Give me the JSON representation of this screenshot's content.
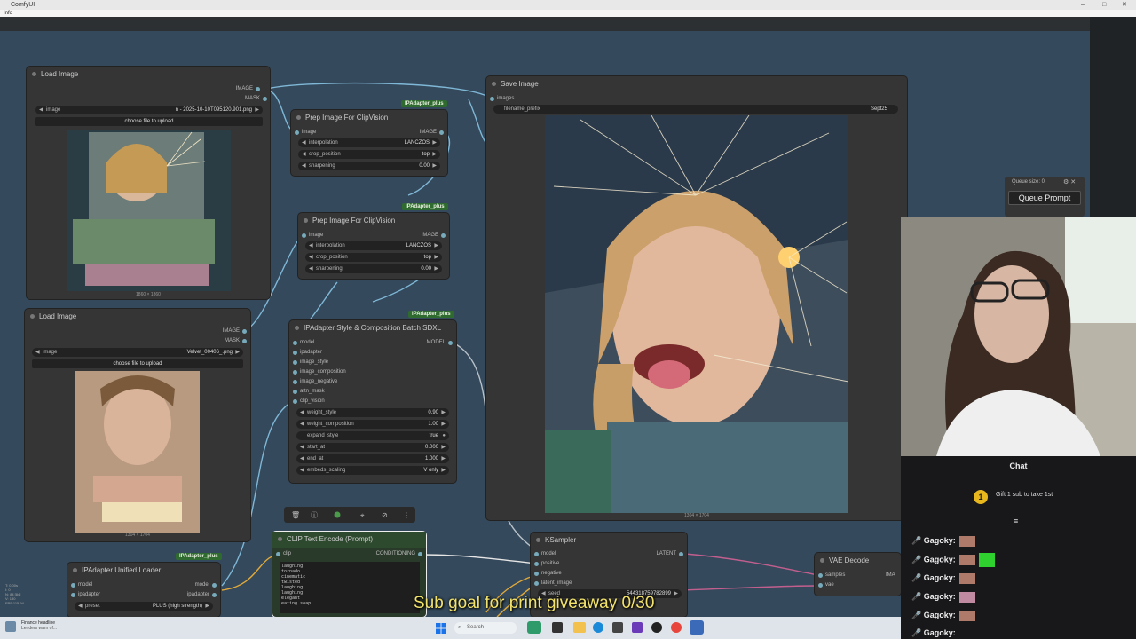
{
  "window": {
    "title": "ComfyUI",
    "menu": "Info"
  },
  "colors": {
    "canvas": "#34495b",
    "node": "#353535",
    "wire_pink": "#c35f8f",
    "wire_blue": "#7fb7d6",
    "wire_yellow": "#e0a93a",
    "badge": "#2f6b2f",
    "subgoal": "#f3e36b"
  },
  "nodes": {
    "load_image_1": {
      "title": "Load Image",
      "outputs": [
        "IMAGE",
        "MASK"
      ],
      "image_label": "image",
      "image_value": "n - 2025-10-10T095120.901.png",
      "upload": "choose file to upload",
      "caption": "1860 × 1860"
    },
    "load_image_2": {
      "title": "Load Image",
      "outputs": [
        "IMAGE",
        "MASK"
      ],
      "image_label": "image",
      "image_value": "Velvet_00406_.png",
      "upload": "choose file to upload",
      "caption": "1304 × 1704"
    },
    "prep_1": {
      "title": "Prep Image For ClipVision",
      "badge": "IPAdapter_plus",
      "input": "image",
      "output": "IMAGE",
      "widgets": [
        {
          "label": "interpolation",
          "value": "LANCZOS"
        },
        {
          "label": "crop_position",
          "value": "top"
        },
        {
          "label": "sharpening",
          "value": "0.00"
        }
      ]
    },
    "prep_2": {
      "title": "Prep Image For ClipVision",
      "badge": "IPAdapter_plus",
      "input": "image",
      "output": "IMAGE",
      "widgets": [
        {
          "label": "interpolation",
          "value": "LANCZOS"
        },
        {
          "label": "crop_position",
          "value": "top"
        },
        {
          "label": "sharpening",
          "value": "0.00"
        }
      ]
    },
    "ipadapter_style": {
      "title": "IPAdapter Style & Composition Batch SDXL",
      "badge": "IPAdapter_plus",
      "output": "MODEL",
      "inputs": [
        "model",
        "ipadapter",
        "image_style",
        "image_composition",
        "image_negative",
        "attn_mask",
        "clip_vision"
      ],
      "widgets": [
        {
          "label": "weight_style",
          "value": "0.90"
        },
        {
          "label": "weight_composition",
          "value": "1.00"
        },
        {
          "label": "expand_style",
          "value": "true"
        },
        {
          "label": "start_at",
          "value": "0.000"
        },
        {
          "label": "end_at",
          "value": "1.000"
        },
        {
          "label": "embeds_scaling",
          "value": "V only"
        }
      ]
    },
    "save_image": {
      "title": "Save Image",
      "input": "images",
      "widget_label": "filename_prefix",
      "widget_value": "Sept25",
      "caption": "1304 × 1704"
    },
    "clip_text": {
      "title": "CLIP Text Encode (Prompt)",
      "input": "clip",
      "output": "CONDITIONING",
      "text": [
        "laughing",
        "tornado",
        "cinematic",
        "twisted",
        "laughing",
        "laughing",
        "elegant",
        "eating soap"
      ]
    },
    "ksampler": {
      "title": "KSampler",
      "output": "LATENT",
      "inputs": [
        "model",
        "positive",
        "negative",
        "latent_image"
      ],
      "seed_label": "seed",
      "seed_value": "544318759782899"
    },
    "vae_decode": {
      "title": "VAE Decode",
      "inputs": [
        "samples",
        "vae"
      ],
      "output": "IMA"
    },
    "unified_loader": {
      "title": "IPAdapter Unified Loader",
      "badge": "IPAdapter_plus",
      "inputs": [
        "model",
        "ipadapter"
      ],
      "outputs": [
        "model",
        "ipadapter"
      ],
      "preset_label": "preset",
      "preset_value": "PLUS (high strength)"
    }
  },
  "queue": {
    "size_label": "Queue size: 0",
    "button": "Queue Prompt"
  },
  "chat": {
    "title": "Chat",
    "pinned": "Gift 1 sub to take 1st",
    "messages": [
      {
        "user": "Gagoky:"
      },
      {
        "user": "Gagoky:"
      },
      {
        "user": "Gagoky:"
      },
      {
        "user": "Gagoky:"
      },
      {
        "user": "Gagoky:"
      },
      {
        "user": "Gagoky:"
      }
    ]
  },
  "overlay": {
    "subgoal": "Sub goal for print giveaway 0/30"
  },
  "taskbar": {
    "news_title": "Finance headline",
    "news_sub": "Lenders warn of...",
    "search": "Search"
  },
  "stats": [
    "T: 0.00s",
    "I: 0",
    "N: 84 [84]",
    "V: 180",
    "FPS:115.94"
  ]
}
